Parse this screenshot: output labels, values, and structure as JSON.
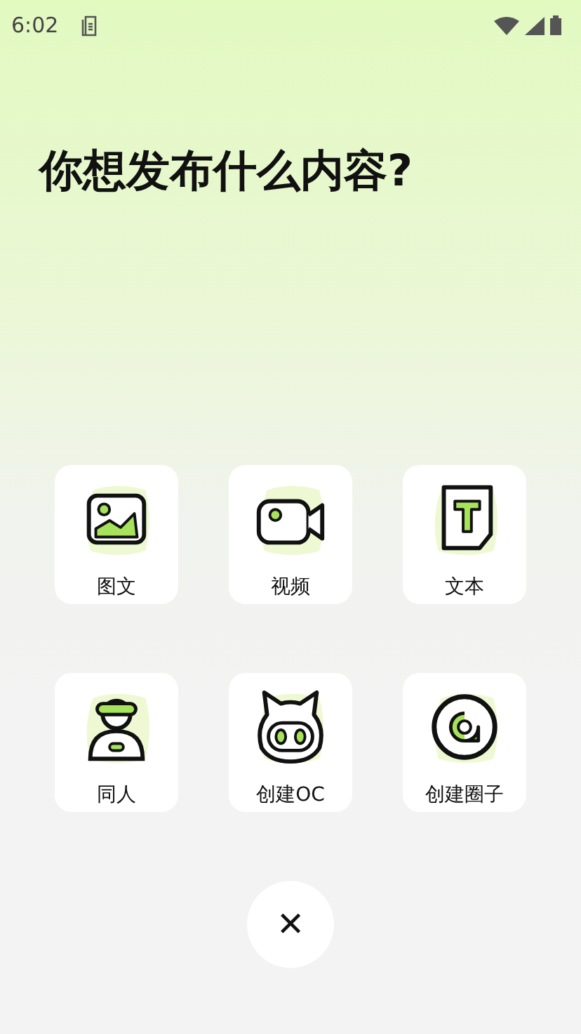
{
  "status_bar": {
    "time": "6:02"
  },
  "title": "你想发布什么内容?",
  "options": [
    {
      "kind": "image",
      "label": "图文"
    },
    {
      "kind": "video",
      "label": "视频"
    },
    {
      "kind": "text",
      "label": "文本"
    },
    {
      "kind": "person",
      "label": "同人"
    },
    {
      "kind": "cat",
      "label": "创建OC"
    },
    {
      "kind": "circle",
      "label": "创建圈子"
    }
  ],
  "close_button": {
    "label": "✕"
  }
}
